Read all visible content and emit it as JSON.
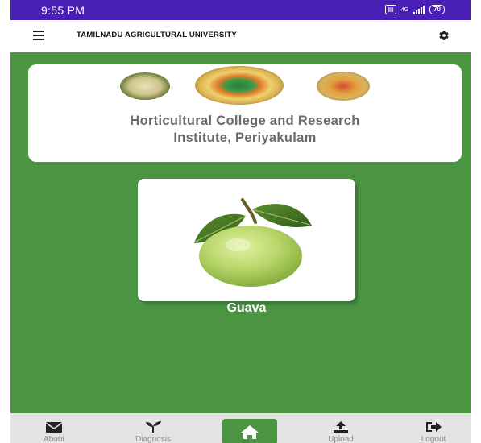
{
  "status_bar": {
    "time": "9:55 PM",
    "network": "4G",
    "battery": "70"
  },
  "app_bar": {
    "title": "TAMILNADU AGRICULTURAL UNIVERSITY",
    "menu_icon": "hamburger-menu-icon",
    "settings_icon": "gear-icon"
  },
  "college_card": {
    "name_line1": "Horticultural College and Research",
    "name_line2": "Institute, Periyakulam"
  },
  "crop_card": {
    "name": "Guava"
  },
  "bottom_nav": {
    "items": [
      {
        "label": "About",
        "icon": "envelope-icon"
      },
      {
        "label": "Diagnosis",
        "icon": "sprout-icon"
      },
      {
        "label": "",
        "icon": "home-icon"
      },
      {
        "label": "Upload",
        "icon": "upload-icon"
      },
      {
        "label": "Logout",
        "icon": "logout-icon"
      }
    ]
  },
  "colors": {
    "status_bar": "#4a1fb3",
    "primary_green": "#4a9442",
    "nav_background": "#e4e4e4"
  }
}
